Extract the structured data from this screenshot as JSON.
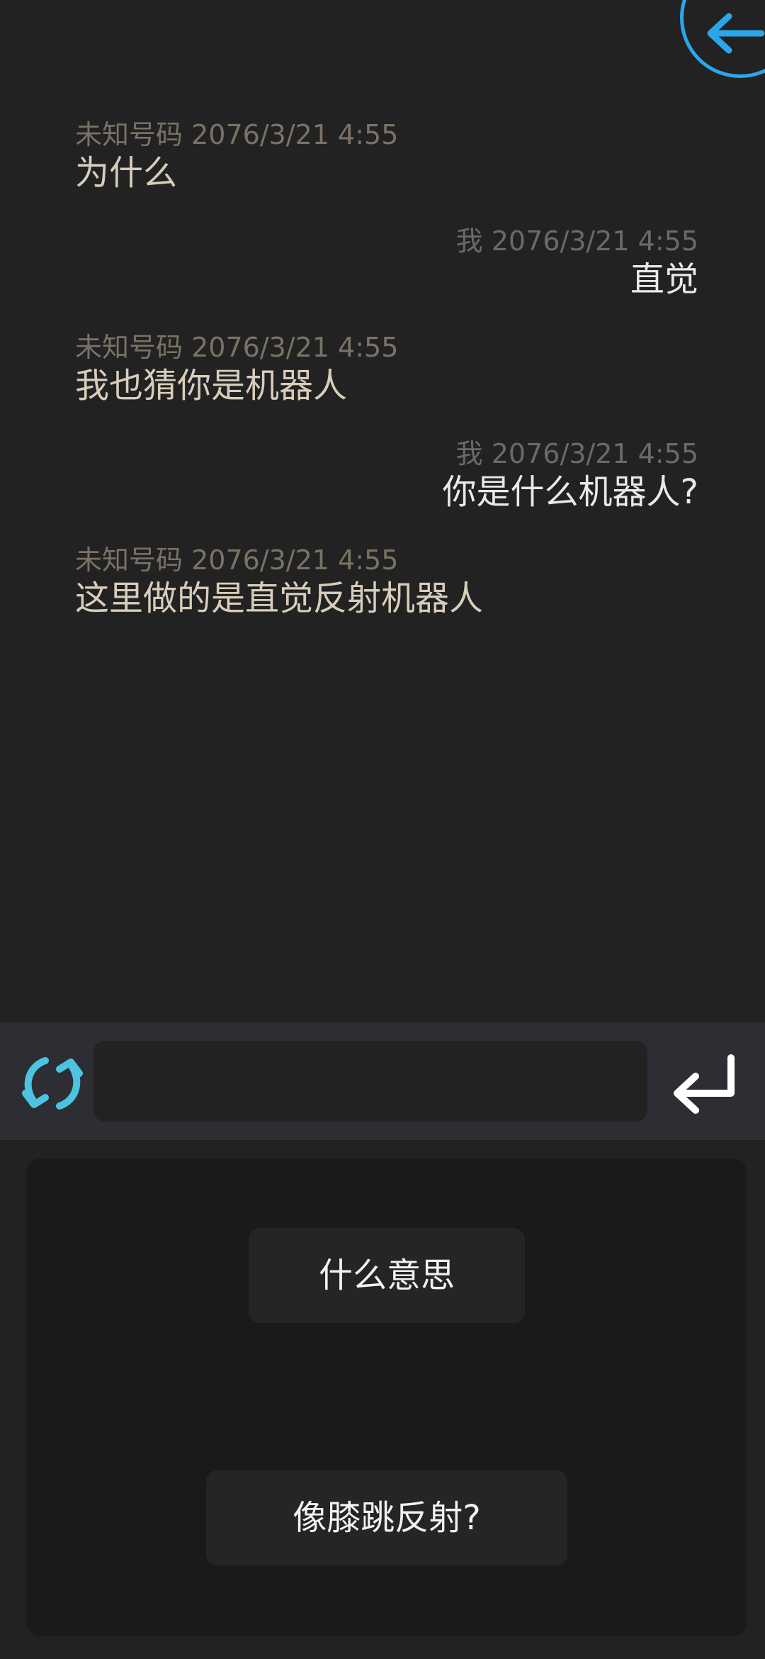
{
  "colors": {
    "accent_blue": "#2aa7ea",
    "refresh_cyan": "#4ec3e0",
    "background": "#222222",
    "input_bar": "#2c2e33",
    "options_panel": "#1a1a1a"
  },
  "header": {
    "back_icon": "arrow-left-icon"
  },
  "messages": [
    {
      "sender": "未知号码",
      "time": "2076/3/21 4:55",
      "text": "为什么",
      "from_self": false
    },
    {
      "sender": "我",
      "time": "2076/3/21 4:55",
      "text": "直觉",
      "from_self": true
    },
    {
      "sender": "未知号码",
      "time": "2076/3/21 4:55",
      "text": "我也猜你是机器人",
      "from_self": false
    },
    {
      "sender": "我",
      "time": "2076/3/21 4:55",
      "text": "你是什么机器人?",
      "from_self": true
    },
    {
      "sender": "未知号码",
      "time": "2076/3/21 4:55",
      "text": "这里做的是直觉反射机器人",
      "from_self": false
    }
  ],
  "input_bar": {
    "refresh_icon": "refresh-icon",
    "input_value": "",
    "send_icon": "enter-return-icon"
  },
  "options": [
    {
      "label": "什么意思"
    },
    {
      "label": "像膝跳反射?"
    }
  ]
}
